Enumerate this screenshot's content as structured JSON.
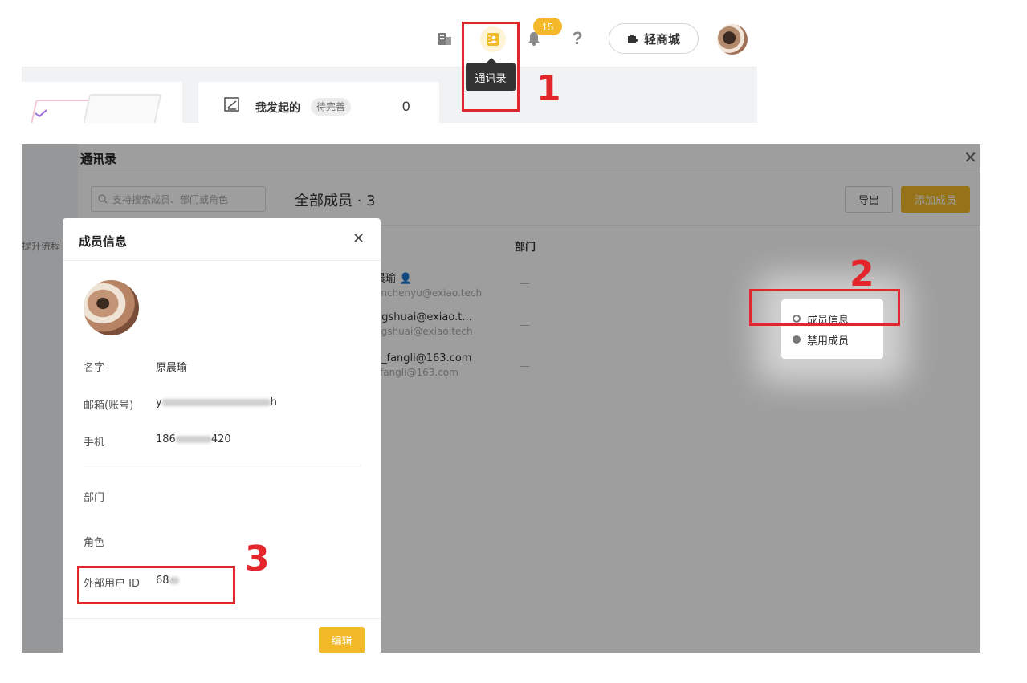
{
  "topbar": {
    "notification_count": "15",
    "mall_label": "轻商城",
    "tooltip": "通讯录",
    "stat_card": {
      "label": "我发起的",
      "tag": "待完善",
      "count": "0"
    },
    "icons": [
      "building-icon",
      "contacts-icon",
      "bell-icon",
      "help-icon",
      "puzzle-icon"
    ]
  },
  "annotations": {
    "step1": "1",
    "step2": "2",
    "step3": "3",
    "accent_color": "#e3262b"
  },
  "contacts": {
    "title": "通讯录",
    "search_placeholder": "支持搜索成员、部门或角色",
    "members_heading": "全部成员 · 3",
    "export_label": "导出",
    "add_label": "添加成员",
    "dept_column": "部门",
    "underlay_text": "提升流程",
    "members": [
      {
        "name": "晨瑜",
        "email": "anchenyu@exiao.tech",
        "dept": "—"
      },
      {
        "name": "ngshuai@exiao.t...",
        "email": "ngshuai@exiao.tech",
        "dept": "—"
      },
      {
        "name": "e_fangli@163.com",
        "email": "_fangli@163.com",
        "dept": "—"
      }
    ],
    "menu": {
      "info": "成员信息",
      "disable": "禁用成员"
    }
  },
  "dialog": {
    "title": "成员信息",
    "name_label": "名字",
    "name_value": "原晨瑜",
    "email_label": "邮箱(账号)",
    "email_prefix": "y",
    "email_suffix": "h",
    "phone_label": "手机",
    "phone_prefix": "186",
    "phone_suffix": "420",
    "dept_label": "部门",
    "role_label": "角色",
    "external_id_label": "外部用户 ID",
    "external_id_prefix": "68",
    "edit_label": "编辑"
  },
  "colors": {
    "brand_yellow": "#f2b928",
    "badge_yellow": "#f4b82a",
    "mask": "rgba(0,0,0,0.38)"
  }
}
